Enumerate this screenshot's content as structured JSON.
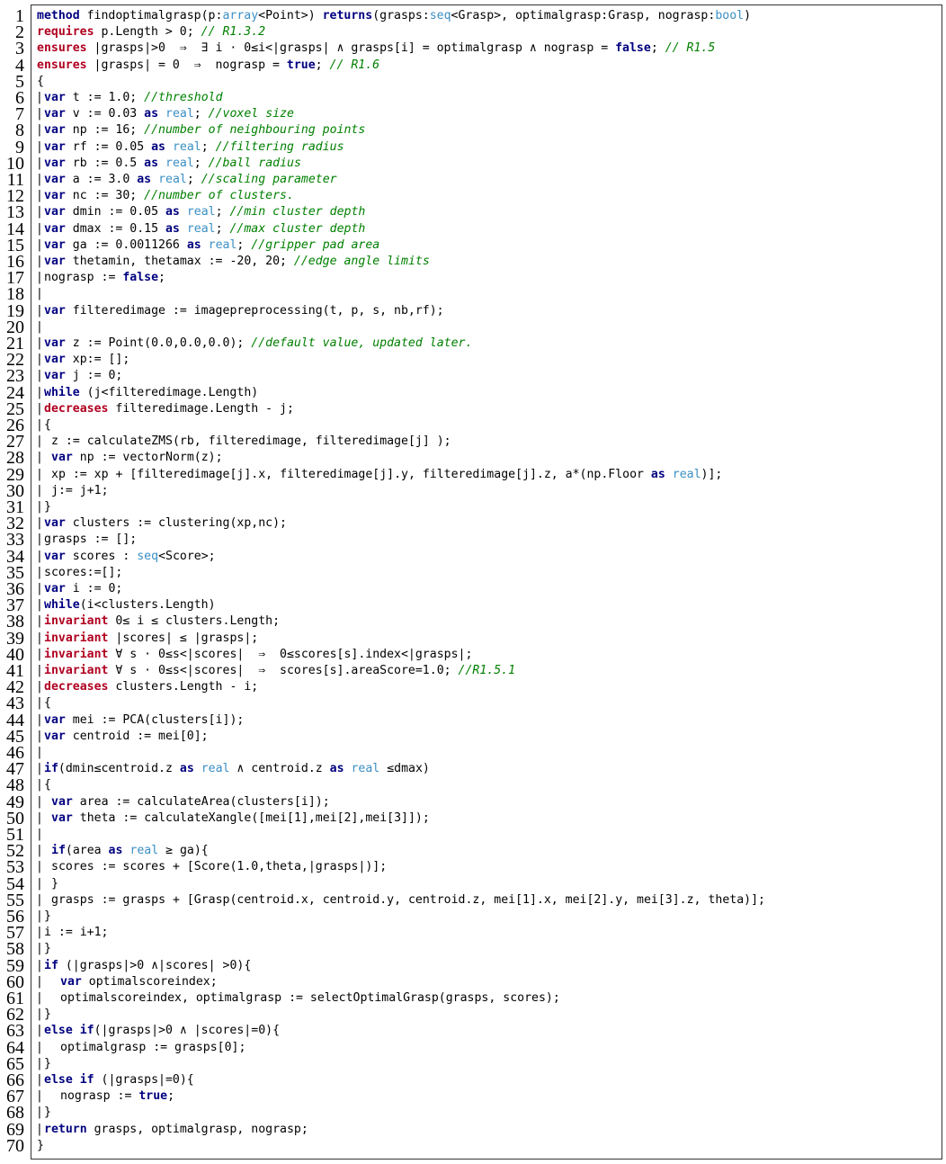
{
  "colors": {
    "keyword": "#000080",
    "spec_keyword": "#b00020",
    "type": "#3b8fc4",
    "comment": "#008000",
    "text": "#000000"
  },
  "lines": [
    {
      "n": "1",
      "indent": 0,
      "tokens": [
        [
          "kw",
          "method"
        ],
        [
          "t",
          " findoptimalgrasp(p:"
        ],
        [
          "ty",
          "array"
        ],
        [
          "t",
          "<Point>) "
        ],
        [
          "kw",
          "returns"
        ],
        [
          "t",
          "(grasps:"
        ],
        [
          "ty",
          "seq"
        ],
        [
          "t",
          "<Grasp>, optimalgrasp:Grasp, nograsp:"
        ],
        [
          "ty",
          "bool"
        ],
        [
          "t",
          ")"
        ]
      ]
    },
    {
      "n": "2",
      "indent": 0,
      "tokens": [
        [
          "rq",
          "requires"
        ],
        [
          "t",
          " p.Length > 0; "
        ],
        [
          "cm",
          "// R1.3.2"
        ]
      ]
    },
    {
      "n": "3",
      "indent": 0,
      "tokens": [
        [
          "rq",
          "ensures"
        ],
        [
          "t",
          " |grasps|>0  ⇒  ∃ i · 0≤i<|grasps| ∧ grasps[i] = optimalgrasp ∧ nograsp = "
        ],
        [
          "kw",
          "false"
        ],
        [
          "t",
          "; "
        ],
        [
          "cm",
          "// R1.5"
        ]
      ]
    },
    {
      "n": "4",
      "indent": 0,
      "tokens": [
        [
          "rq",
          "ensures"
        ],
        [
          "t",
          " |grasps| = 0  ⇒  nograsp = "
        ],
        [
          "kw",
          "true"
        ],
        [
          "t",
          "; "
        ],
        [
          "cm",
          "// R1.6"
        ]
      ]
    },
    {
      "n": "5",
      "indent": 0,
      "tokens": [
        [
          "t",
          "{"
        ]
      ]
    },
    {
      "n": "6",
      "indent": 1,
      "tokens": [
        [
          "kw",
          "var"
        ],
        [
          "t",
          " t := 1.0; "
        ],
        [
          "cm",
          "//threshold"
        ]
      ]
    },
    {
      "n": "7",
      "indent": 1,
      "tokens": [
        [
          "kw",
          "var"
        ],
        [
          "t",
          " v := 0.03 "
        ],
        [
          "kw",
          "as"
        ],
        [
          "t",
          " "
        ],
        [
          "ty",
          "real"
        ],
        [
          "t",
          "; "
        ],
        [
          "cm",
          "//voxel size"
        ]
      ]
    },
    {
      "n": "8",
      "indent": 1,
      "tokens": [
        [
          "kw",
          "var"
        ],
        [
          "t",
          " np := 16; "
        ],
        [
          "cm",
          "//number of neighbouring points"
        ]
      ]
    },
    {
      "n": "9",
      "indent": 1,
      "tokens": [
        [
          "kw",
          "var"
        ],
        [
          "t",
          " rf := 0.05 "
        ],
        [
          "kw",
          "as"
        ],
        [
          "t",
          " "
        ],
        [
          "ty",
          "real"
        ],
        [
          "t",
          "; "
        ],
        [
          "cm",
          "//filtering radius"
        ]
      ]
    },
    {
      "n": "10",
      "indent": 1,
      "tokens": [
        [
          "kw",
          "var"
        ],
        [
          "t",
          " rb := 0.5 "
        ],
        [
          "kw",
          "as"
        ],
        [
          "t",
          " "
        ],
        [
          "ty",
          "real"
        ],
        [
          "t",
          "; "
        ],
        [
          "cm",
          "//ball radius"
        ]
      ]
    },
    {
      "n": "11",
      "indent": 1,
      "tokens": [
        [
          "kw",
          "var"
        ],
        [
          "t",
          " a := 3.0 "
        ],
        [
          "kw",
          "as"
        ],
        [
          "t",
          " "
        ],
        [
          "ty",
          "real"
        ],
        [
          "t",
          "; "
        ],
        [
          "cm",
          "//scaling parameter"
        ]
      ]
    },
    {
      "n": "12",
      "indent": 1,
      "tokens": [
        [
          "kw",
          "var"
        ],
        [
          "t",
          " nc := 30; "
        ],
        [
          "cm",
          "//number of clusters."
        ]
      ]
    },
    {
      "n": "13",
      "indent": 1,
      "tokens": [
        [
          "kw",
          "var"
        ],
        [
          "t",
          " dmin := 0.05 "
        ],
        [
          "kw",
          "as"
        ],
        [
          "t",
          " "
        ],
        [
          "ty",
          "real"
        ],
        [
          "t",
          "; "
        ],
        [
          "cm",
          "//min cluster depth"
        ]
      ]
    },
    {
      "n": "14",
      "indent": 1,
      "tokens": [
        [
          "kw",
          "var"
        ],
        [
          "t",
          " dmax := 0.15 "
        ],
        [
          "kw",
          "as"
        ],
        [
          "t",
          " "
        ],
        [
          "ty",
          "real"
        ],
        [
          "t",
          "; "
        ],
        [
          "cm",
          "//max cluster depth"
        ]
      ]
    },
    {
      "n": "15",
      "indent": 1,
      "tokens": [
        [
          "kw",
          "var"
        ],
        [
          "t",
          " ga := 0.0011266 "
        ],
        [
          "kw",
          "as"
        ],
        [
          "t",
          " "
        ],
        [
          "ty",
          "real"
        ],
        [
          "t",
          "; "
        ],
        [
          "cm",
          "//gripper pad area"
        ]
      ]
    },
    {
      "n": "16",
      "indent": 1,
      "tokens": [
        [
          "kw",
          "var"
        ],
        [
          "t",
          " thetamin, thetamax := -20, 20; "
        ],
        [
          "cm",
          "//edge angle limits"
        ]
      ]
    },
    {
      "n": "17",
      "indent": 1,
      "tokens": [
        [
          "t",
          "nograsp := "
        ],
        [
          "kw",
          "false"
        ],
        [
          "t",
          ";"
        ]
      ]
    },
    {
      "n": "18",
      "indent": 1,
      "tokens": []
    },
    {
      "n": "19",
      "indent": 1,
      "tokens": [
        [
          "kw",
          "var"
        ],
        [
          "t",
          " filteredimage := imagepreprocessing(t, p, s, nb,rf);"
        ]
      ]
    },
    {
      "n": "20",
      "indent": 1,
      "tokens": []
    },
    {
      "n": "21",
      "indent": 1,
      "tokens": [
        [
          "kw",
          "var"
        ],
        [
          "t",
          " z := Point(0.0,0.0,0.0); "
        ],
        [
          "cm",
          "//default value, updated later."
        ]
      ]
    },
    {
      "n": "22",
      "indent": 1,
      "tokens": [
        [
          "kw",
          "var"
        ],
        [
          "t",
          " xp:= [];"
        ]
      ]
    },
    {
      "n": "23",
      "indent": 1,
      "tokens": [
        [
          "kw",
          "var"
        ],
        [
          "t",
          " j := 0;"
        ]
      ]
    },
    {
      "n": "24",
      "indent": 1,
      "tokens": [
        [
          "kw",
          "while"
        ],
        [
          "t",
          " (j<filteredimage.Length)"
        ]
      ]
    },
    {
      "n": "25",
      "indent": 1,
      "tokens": [
        [
          "rq",
          "decreases"
        ],
        [
          "t",
          " filteredimage.Length - j;"
        ]
      ]
    },
    {
      "n": "26",
      "indent": 1,
      "tokens": [
        [
          "t",
          "{"
        ]
      ]
    },
    {
      "n": "27",
      "indent": 2,
      "tokens": [
        [
          "t",
          "z := calculateZMS(rb, filteredimage, filteredimage[j] );"
        ]
      ]
    },
    {
      "n": "28",
      "indent": 2,
      "tokens": [
        [
          "kw",
          "var"
        ],
        [
          "t",
          " np := vectorNorm(z);"
        ]
      ]
    },
    {
      "n": "29",
      "indent": 2,
      "tokens": [
        [
          "t",
          "xp := xp + [filteredimage[j].x, filteredimage[j].y, filteredimage[j].z, a*(np.Floor "
        ],
        [
          "kw",
          "as"
        ],
        [
          "t",
          " "
        ],
        [
          "ty",
          "real"
        ],
        [
          "t",
          ")];"
        ]
      ]
    },
    {
      "n": "30",
      "indent": 2,
      "tokens": [
        [
          "t",
          "j:= j+1;"
        ]
      ]
    },
    {
      "n": "31",
      "indent": 1,
      "tokens": [
        [
          "t",
          "}"
        ]
      ]
    },
    {
      "n": "32",
      "indent": 1,
      "tokens": [
        [
          "kw",
          "var"
        ],
        [
          "t",
          " clusters := clustering(xp,nc);"
        ]
      ]
    },
    {
      "n": "33",
      "indent": 1,
      "tokens": [
        [
          "t",
          "grasps := [];"
        ]
      ]
    },
    {
      "n": "34",
      "indent": 1,
      "tokens": [
        [
          "kw",
          "var"
        ],
        [
          "t",
          " scores : "
        ],
        [
          "ty",
          "seq"
        ],
        [
          "t",
          "<Score>;"
        ]
      ]
    },
    {
      "n": "35",
      "indent": 1,
      "tokens": [
        [
          "t",
          "scores:=[];"
        ]
      ]
    },
    {
      "n": "36",
      "indent": 1,
      "tokens": [
        [
          "kw",
          "var"
        ],
        [
          "t",
          " i := 0;"
        ]
      ]
    },
    {
      "n": "37",
      "indent": 1,
      "tokens": [
        [
          "kw",
          "while"
        ],
        [
          "t",
          "(i<clusters.Length)"
        ]
      ]
    },
    {
      "n": "38",
      "indent": 1,
      "tokens": [
        [
          "rq",
          "invariant"
        ],
        [
          "t",
          " 0≤ i ≤ clusters.Length;"
        ]
      ]
    },
    {
      "n": "39",
      "indent": 1,
      "tokens": [
        [
          "rq",
          "invariant"
        ],
        [
          "t",
          " |scores| ≤ |grasps|;"
        ]
      ]
    },
    {
      "n": "40",
      "indent": 1,
      "tokens": [
        [
          "rq",
          "invariant"
        ],
        [
          "t",
          " ∀ s · 0≤s<|scores|  ⇒  0≤scores[s].index<|grasps|;"
        ]
      ]
    },
    {
      "n": "41",
      "indent": 1,
      "tokens": [
        [
          "rq",
          "invariant"
        ],
        [
          "t",
          " ∀ s · 0≤s<|scores|  ⇒  scores[s].areaScore=1.0; "
        ],
        [
          "cm",
          "//R1.5.1"
        ]
      ]
    },
    {
      "n": "42",
      "indent": 1,
      "tokens": [
        [
          "rq",
          "decreases"
        ],
        [
          "t",
          " clusters.Length - i;"
        ]
      ]
    },
    {
      "n": "43",
      "indent": 1,
      "tokens": [
        [
          "t",
          "{"
        ]
      ]
    },
    {
      "n": "44",
      "indent": 1,
      "tokens": [
        [
          "kw",
          "var"
        ],
        [
          "t",
          " mei := PCA(clusters[i]);"
        ]
      ]
    },
    {
      "n": "45",
      "indent": 1,
      "tokens": [
        [
          "kw",
          "var"
        ],
        [
          "t",
          " centroid := mei[0];"
        ]
      ]
    },
    {
      "n": "46",
      "indent": 1,
      "tokens": []
    },
    {
      "n": "47",
      "indent": 1,
      "tokens": [
        [
          "kw",
          "if"
        ],
        [
          "t",
          "(dmin≤centroid.z "
        ],
        [
          "kw",
          "as"
        ],
        [
          "t",
          " "
        ],
        [
          "ty",
          "real"
        ],
        [
          "t",
          " ∧ centroid.z "
        ],
        [
          "kw",
          "as"
        ],
        [
          "t",
          " "
        ],
        [
          "ty",
          "real"
        ],
        [
          "t",
          " ≤dmax)"
        ]
      ]
    },
    {
      "n": "48",
      "indent": 1,
      "tokens": [
        [
          "t",
          "{"
        ]
      ]
    },
    {
      "n": "49",
      "indent": 2,
      "tokens": [
        [
          "kw",
          "var"
        ],
        [
          "t",
          " area := calculateArea(clusters[i]);"
        ]
      ]
    },
    {
      "n": "50",
      "indent": 2,
      "tokens": [
        [
          "kw",
          "var"
        ],
        [
          "t",
          " theta := calculateXangle([mei[1],mei[2],mei[3]]);"
        ]
      ]
    },
    {
      "n": "51",
      "indent": 1,
      "tokens": []
    },
    {
      "n": "52",
      "indent": 2,
      "tokens": [
        [
          "kw",
          "if"
        ],
        [
          "t",
          "(area "
        ],
        [
          "kw",
          "as"
        ],
        [
          "t",
          " "
        ],
        [
          "ty",
          "real"
        ],
        [
          "t",
          " ≥ ga){"
        ]
      ]
    },
    {
      "n": "53",
      "indent": 2,
      "tokens": [
        [
          "t",
          "scores := scores + [Score(1.0,theta,|grasps|)];"
        ]
      ]
    },
    {
      "n": "54",
      "indent": 2,
      "tokens": [
        [
          "t",
          "}"
        ]
      ]
    },
    {
      "n": "55",
      "indent": 2,
      "tokens": [
        [
          "t",
          "grasps := grasps + [Grasp(centroid.x, centroid.y, centroid.z, mei[1].x, mei[2].y, mei[3].z, theta)];"
        ]
      ]
    },
    {
      "n": "56",
      "indent": 1,
      "tokens": [
        [
          "t",
          "}"
        ]
      ]
    },
    {
      "n": "57",
      "indent": 1,
      "tokens": [
        [
          "t",
          "i := i+1;"
        ]
      ]
    },
    {
      "n": "58",
      "indent": 1,
      "tokens": [
        [
          "t",
          "}"
        ]
      ]
    },
    {
      "n": "59",
      "indent": 1,
      "tokens": [
        [
          "kw",
          "if"
        ],
        [
          "t",
          " (|grasps|>0 ∧|scores| >0){"
        ]
      ]
    },
    {
      "n": "60",
      "indent": 3,
      "tokens": [
        [
          "kw",
          "var"
        ],
        [
          "t",
          " optimalscoreindex;"
        ]
      ]
    },
    {
      "n": "61",
      "indent": 3,
      "tokens": [
        [
          "t",
          "optimalscoreindex, optimalgrasp := selectOptimalGrasp(grasps, scores);"
        ]
      ]
    },
    {
      "n": "62",
      "indent": 1,
      "tokens": [
        [
          "t",
          "}"
        ]
      ]
    },
    {
      "n": "63",
      "indent": 1,
      "tokens": [
        [
          "kw",
          "else if"
        ],
        [
          "t",
          "(|grasps|>0 ∧ |scores|=0){"
        ]
      ]
    },
    {
      "n": "64",
      "indent": 3,
      "tokens": [
        [
          "t",
          "optimalgrasp := grasps[0];"
        ]
      ]
    },
    {
      "n": "65",
      "indent": 1,
      "tokens": [
        [
          "t",
          "}"
        ]
      ]
    },
    {
      "n": "66",
      "indent": 1,
      "tokens": [
        [
          "kw",
          "else if"
        ],
        [
          "t",
          " (|grasps|=0){"
        ]
      ]
    },
    {
      "n": "67",
      "indent": 3,
      "tokens": [
        [
          "t",
          "nograsp := "
        ],
        [
          "kw",
          "true"
        ],
        [
          "t",
          ";"
        ]
      ]
    },
    {
      "n": "68",
      "indent": 1,
      "tokens": [
        [
          "t",
          "}"
        ]
      ]
    },
    {
      "n": "69",
      "indent": 1,
      "tokens": [
        [
          "kw",
          "return"
        ],
        [
          "t",
          " grasps, optimalgrasp, nograsp;"
        ]
      ]
    },
    {
      "n": "70",
      "indent": 0,
      "tokens": [
        [
          "t",
          "}"
        ]
      ]
    }
  ]
}
